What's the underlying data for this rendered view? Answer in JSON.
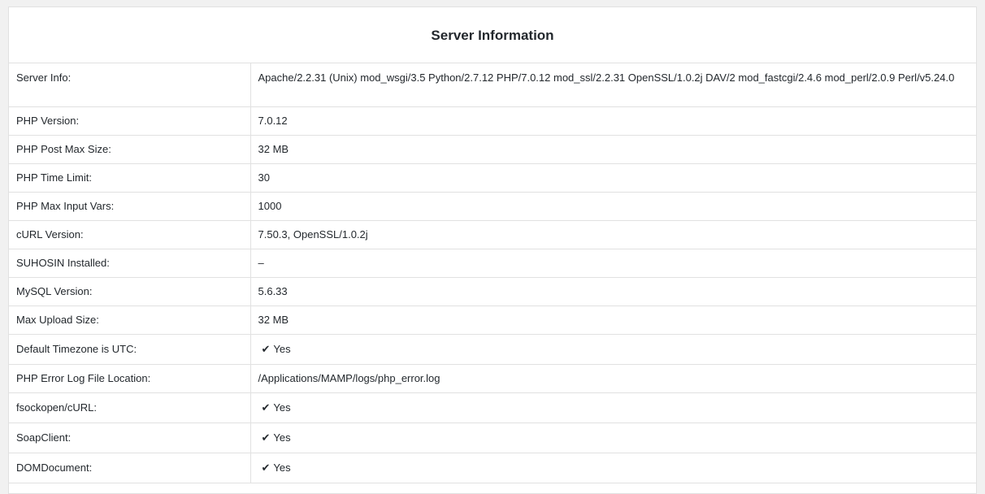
{
  "panel": {
    "title": "Server Information"
  },
  "check_icon": "✔",
  "rows": [
    {
      "label": "Server Info:",
      "value": "Apache/2.2.31 (Unix) mod_wsgi/3.5 Python/2.7.12 PHP/7.0.12 mod_ssl/2.2.31 OpenSSL/1.0.2j DAV/2 mod_fastcgi/2.4.6 mod_perl/2.0.9 Perl/v5.24.0"
    },
    {
      "label": "PHP Version:",
      "value": "7.0.12"
    },
    {
      "label": "PHP Post Max Size:",
      "value": "32 MB"
    },
    {
      "label": "PHP Time Limit:",
      "value": "30"
    },
    {
      "label": "PHP Max Input Vars:",
      "value": "1000"
    },
    {
      "label": "cURL Version:",
      "value": "7.50.3, OpenSSL/1.0.2j"
    },
    {
      "label": "SUHOSIN Installed:",
      "value": "–"
    },
    {
      "label": "MySQL Version:",
      "value": "5.6.33"
    },
    {
      "label": "Max Upload Size:",
      "value": "32 MB"
    },
    {
      "label": "Default Timezone is UTC:",
      "value": "Yes"
    },
    {
      "label": "PHP Error Log File Location:",
      "value": "/Applications/MAMP/logs/php_error.log"
    },
    {
      "label": "fsockopen/cURL:",
      "value": "Yes"
    },
    {
      "label": "SoapClient:",
      "value": "Yes"
    },
    {
      "label": "DOMDocument:",
      "value": "Yes"
    }
  ]
}
